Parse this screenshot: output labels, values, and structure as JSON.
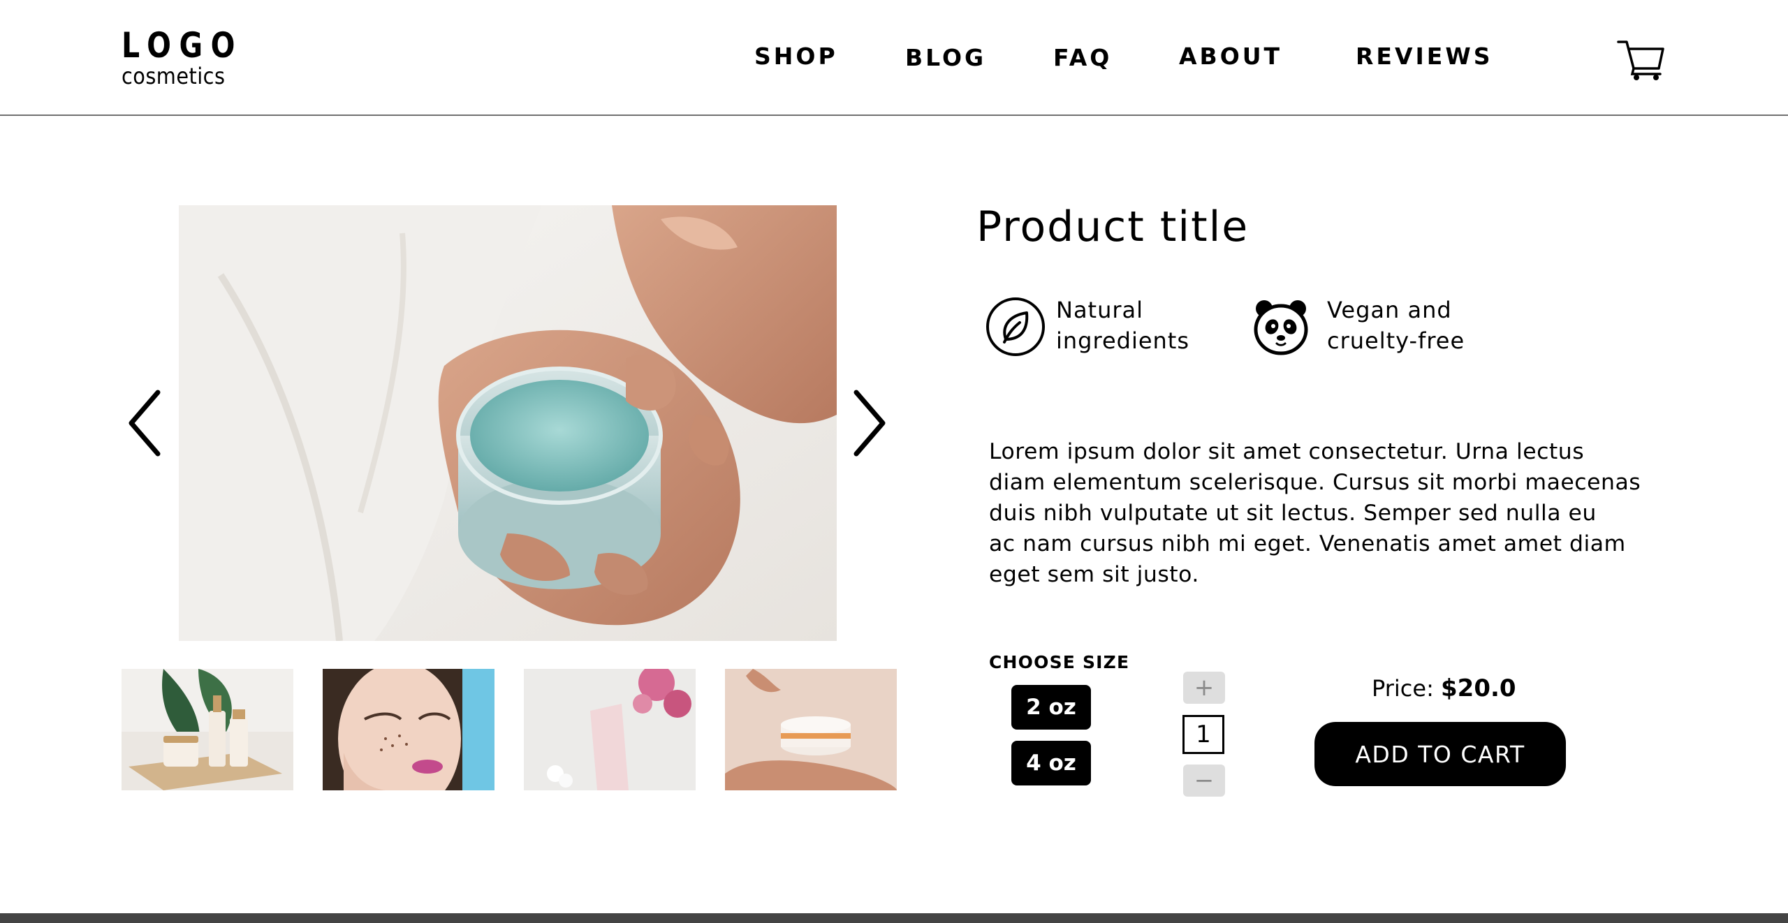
{
  "header": {
    "logo_main": "LOGO",
    "logo_sub": "cosmetics",
    "nav": [
      {
        "label": "SHOP"
      },
      {
        "label": "BLOG"
      },
      {
        "label": "FAQ"
      },
      {
        "label": "ABOUT"
      },
      {
        "label": "REVIEWS"
      }
    ],
    "cart_icon": "shopping-cart-icon"
  },
  "gallery": {
    "main_image": "hands-holding-gel-jar-photo",
    "prev_icon": "chevron-left-icon",
    "next_icon": "chevron-right-icon",
    "thumbnails": [
      {
        "image": "skincare-set-with-leaf-photo"
      },
      {
        "image": "woman-face-glitter-photo"
      },
      {
        "image": "pink-tube-with-roses-photo"
      },
      {
        "image": "cream-jar-on-palm-photo"
      }
    ]
  },
  "product": {
    "title": "Product title",
    "features": [
      {
        "icon": "leaf-icon",
        "text": "Natural\ningredients"
      },
      {
        "icon": "panda-icon",
        "text": "Vegan and\ncruelty-free"
      }
    ],
    "description": "Lorem ipsum dolor sit amet consectetur. Urna lectus\ndiam elementum scelerisque. Cursus sit morbi maecenas\nduis nibh vulputate ut sit lectus. Semper sed nulla eu\nac nam cursus nibh mi eget. Venenatis amet amet diam\neget sem sit justo.",
    "size_label": "CHOOSE SIZE",
    "sizes": [
      "2 oz",
      "4 oz"
    ],
    "quantity": "1",
    "plus_label": "+",
    "minus_label": "−",
    "price_label": "Price:",
    "price_value": "$20.0",
    "add_to_cart": "ADD TO CART"
  }
}
